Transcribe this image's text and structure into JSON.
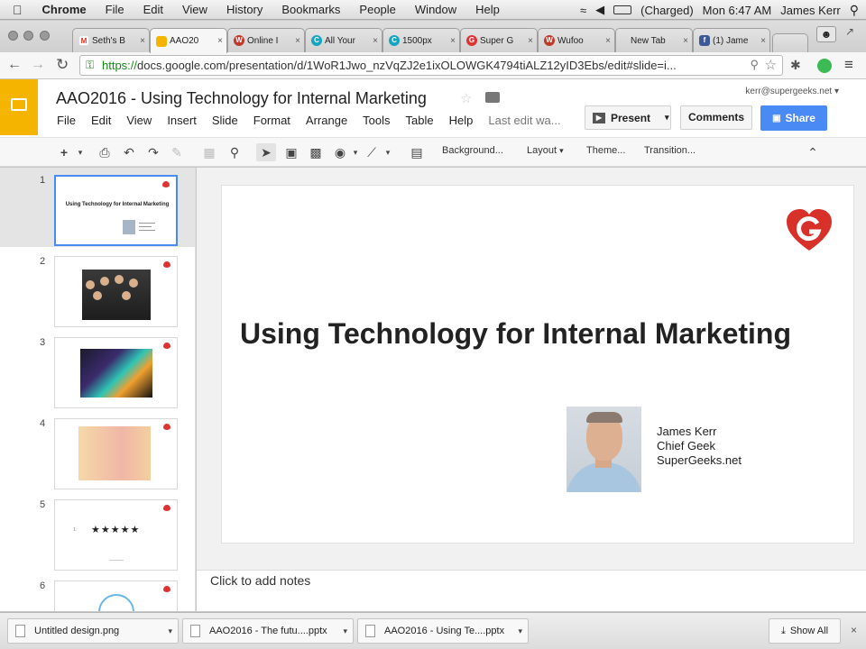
{
  "menubar": {
    "app": "Chrome",
    "items": [
      "File",
      "Edit",
      "View",
      "History",
      "Bookmarks",
      "People",
      "Window",
      "Help"
    ],
    "battery": "(Charged)",
    "clock": "Mon 6:47 AM",
    "user": "James Kerr"
  },
  "tabs": [
    {
      "label": "Seth's B",
      "fav_color": "#d93025",
      "fav": "M"
    },
    {
      "label": "AAO20",
      "fav_color": "#f4b400",
      "fav": ""
    },
    {
      "label": "Online I",
      "fav_color": "#c0392b",
      "fav": "W"
    },
    {
      "label": "All Your",
      "fav_color": "#16a4c3",
      "fav": "C"
    },
    {
      "label": "1500px",
      "fav_color": "#16a4c3",
      "fav": "C"
    },
    {
      "label": "Super G",
      "fav_color": "#d33",
      "fav": "G"
    },
    {
      "label": "Wufoo",
      "fav_color": "#c0392b",
      "fav": "W"
    },
    {
      "label": "New Tab",
      "fav_color": "",
      "fav": ""
    },
    {
      "label": "(1) Jame",
      "fav_color": "#3b5998",
      "fav": "f"
    }
  ],
  "address": {
    "scheme": "https://",
    "url": "docs.google.com/presentation/d/1WoR1Jwo_nzVqZJ2e1ixOLOWGK4794tiALZ12yID3Ebs/edit#slide=i..."
  },
  "doc": {
    "title": "AAO2016 - Using Technology for Internal Marketing",
    "account": "kerr@supergeeks.net",
    "menus": [
      "File",
      "Edit",
      "View",
      "Insert",
      "Slide",
      "Format",
      "Arrange",
      "Tools",
      "Table",
      "Help"
    ],
    "last_edit": "Last edit wa...",
    "present": "Present",
    "comments": "Comments",
    "share": "Share"
  },
  "toolbar": {
    "background": "Background...",
    "layout": "Layout",
    "theme": "Theme...",
    "transition": "Transition..."
  },
  "slides": [
    {
      "num": "1",
      "thumb_text": "Using Technology for Internal Marketing"
    },
    {
      "num": "2"
    },
    {
      "num": "3"
    },
    {
      "num": "4"
    },
    {
      "num": "5",
      "stars": "★★★★★"
    },
    {
      "num": "6"
    }
  ],
  "slide": {
    "title": "Using Technology for Internal Marketing",
    "name": "James Kerr",
    "role": "Chief Geek",
    "site": "SuperGeeks.net"
  },
  "notes": {
    "placeholder": "Click to add notes"
  },
  "downloads": [
    {
      "name": "Untitled design.png"
    },
    {
      "name": "AAO2016 - The futu....pptx"
    },
    {
      "name": "AAO2016 - Using Te....pptx"
    }
  ],
  "show_all": "Show All"
}
